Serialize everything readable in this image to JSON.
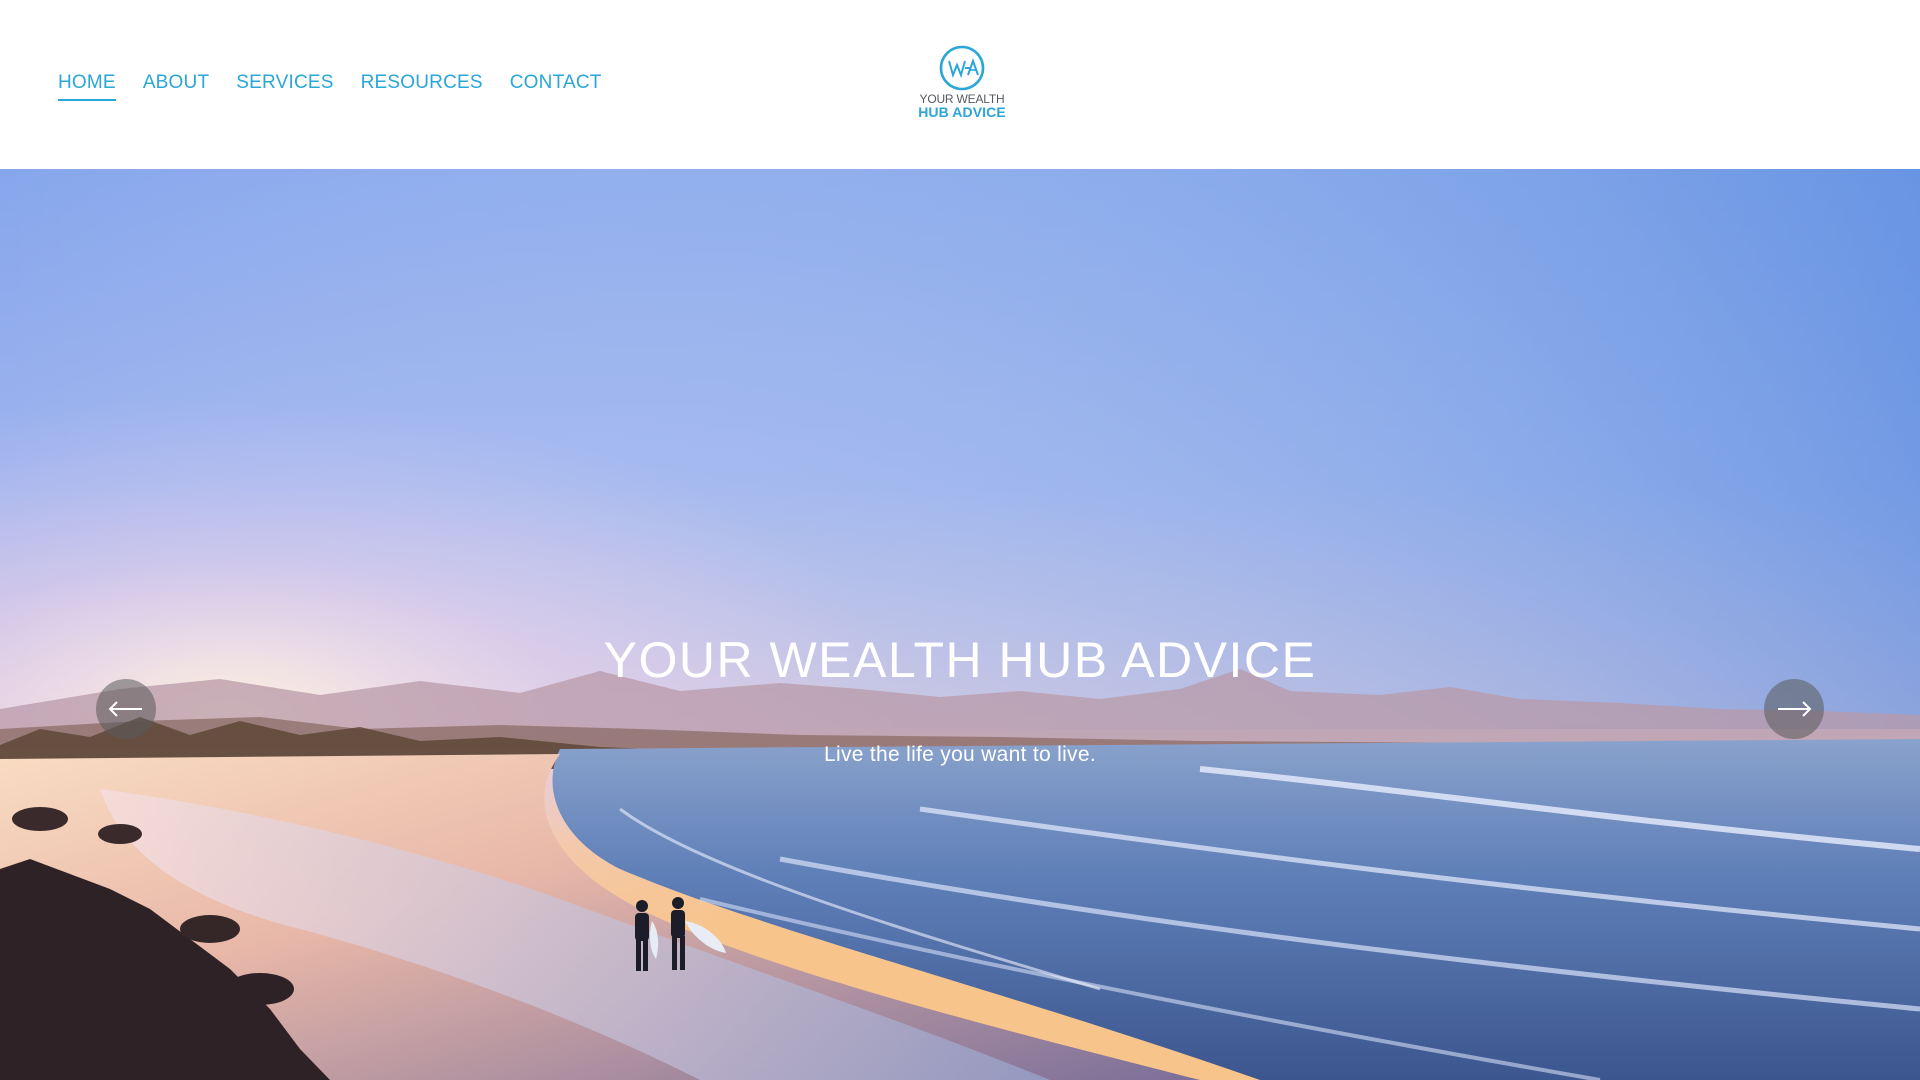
{
  "nav": {
    "items": [
      {
        "label": "HOME",
        "active": true
      },
      {
        "label": "ABOUT",
        "active": false
      },
      {
        "label": "SERVICES",
        "active": false
      },
      {
        "label": "RESOURCES",
        "active": false
      },
      {
        "label": "CONTACT",
        "active": false
      }
    ]
  },
  "logo": {
    "mark_text": "YWHA",
    "line1": "YOUR WEALTH",
    "line2": "HUB ADVICE"
  },
  "hero": {
    "title": "YOUR WEALTH HUB ADVICE",
    "subtitle": "Live the life you want to live.",
    "prev_icon": "arrow-left-icon",
    "next_icon": "arrow-right-icon"
  },
  "colors": {
    "brand": "#2aa6d9",
    "logo_gray": "#555b61",
    "sky_top": "#6f9ee6",
    "horizon": "#f2b97d",
    "sea": "#3f5f9c"
  }
}
